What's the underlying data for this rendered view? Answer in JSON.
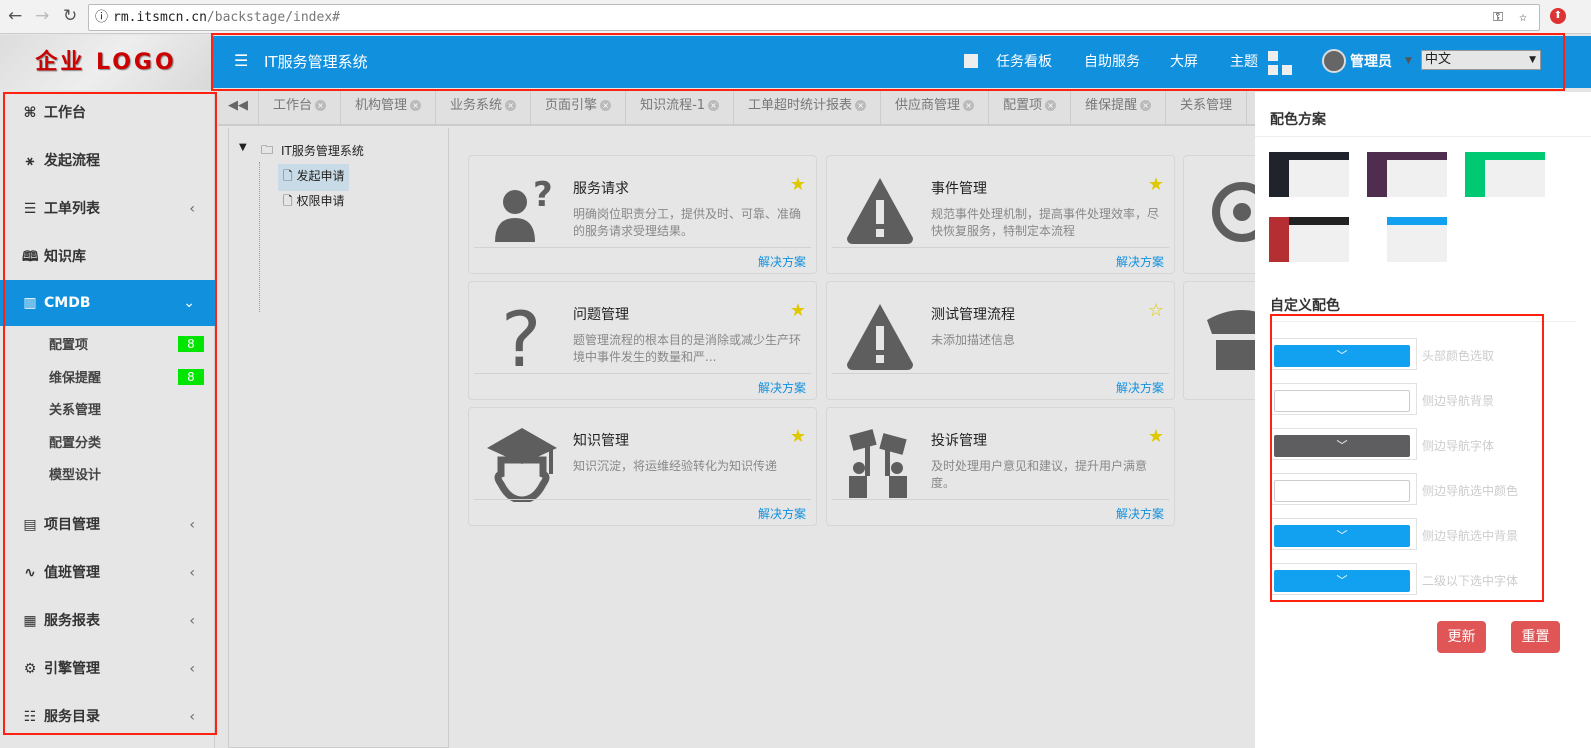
{
  "browser": {
    "url_host": "rm.itsmcn.cn",
    "url_path": "/backstage/index#"
  },
  "logo": "企业 LOGO",
  "header": {
    "title": "IT服务管理系统",
    "links": [
      "任务看板",
      "自助服务",
      "大屏",
      "主题"
    ],
    "user": "管理员",
    "language": "中文",
    "color": "#1190de"
  },
  "tabs": [
    "工作台",
    "机构管理",
    "业务系统",
    "页面引擎",
    "知识流程-1",
    "工单超时统计报表",
    "供应商管理",
    "配置项",
    "维保提醒",
    "关系管理"
  ],
  "sidebar": {
    "items": [
      {
        "label": "工作台",
        "icon": "grid-icon"
      },
      {
        "label": "发起流程",
        "icon": "flow-icon"
      },
      {
        "label": "工单列表",
        "icon": "list-icon",
        "chevron": true
      },
      {
        "label": "知识库",
        "icon": "book-icon"
      },
      {
        "label": "CMDB",
        "icon": "chart-icon",
        "chevron": true,
        "active": true
      },
      {
        "label": "项目管理",
        "icon": "project-icon",
        "chevron": true
      },
      {
        "label": "值班管理",
        "icon": "pulse-icon",
        "chevron": true
      },
      {
        "label": "服务报表",
        "icon": "report-icon",
        "chevron": true
      },
      {
        "label": "引擎管理",
        "icon": "gear-icon",
        "chevron": true
      },
      {
        "label": "服务目录",
        "icon": "catalog-icon",
        "chevron": true
      }
    ],
    "sub": [
      {
        "label": "配置项",
        "badge": "8"
      },
      {
        "label": "维保提醒",
        "badge": "8"
      },
      {
        "label": "关系管理"
      },
      {
        "label": "配置分类"
      },
      {
        "label": "模型设计"
      }
    ]
  },
  "tree": {
    "root": "IT服务管理系统",
    "children": [
      "发起申请",
      "权限申请"
    ],
    "selected": "发起申请"
  },
  "cards": [
    {
      "title": "服务请求",
      "desc": "明确岗位职责分工，提供及时、可靠、准确的服务请求受理结果。",
      "starred": true,
      "icon": "person-question-icon",
      "link": "解决方案"
    },
    {
      "title": "事件管理",
      "desc": "规范事件处理机制，提高事件处理效率，尽快恢复服务，特制定本流程",
      "starred": true,
      "icon": "warning-icon",
      "link": "解决方案"
    },
    {
      "title": "",
      "desc": "",
      "starred": false,
      "icon": "gear-refresh-icon",
      "link": ""
    },
    {
      "title": "问题管理",
      "desc": "题管理流程的根本目的是消除或减少生产环境中事件发生的数量和严...",
      "starred": true,
      "icon": "question-icon",
      "link": "解决方案"
    },
    {
      "title": "测试管理流程",
      "desc": "未添加描述信息",
      "starred": false,
      "icon": "warning-icon",
      "link": "解决方案"
    },
    {
      "title": "",
      "desc": "",
      "starred": false,
      "icon": "police-icon",
      "link": ""
    },
    {
      "title": "知识管理",
      "desc": "知识沉淀，将运维经验转化为知识传递",
      "starred": true,
      "icon": "graduate-icon",
      "link": "解决方案"
    },
    {
      "title": "投诉管理",
      "desc": "及时处理用户意见和建议，提升用户满意度。",
      "starred": true,
      "icon": "protest-icon",
      "link": "解决方案"
    }
  ],
  "panel": {
    "scheme_title": "配色方案",
    "schemes": [
      {
        "side": "#20232b",
        "top": "#20232b"
      },
      {
        "side": "#4f2d4f",
        "top": "#4f2d4f"
      },
      {
        "side": "#00c973",
        "top": "#00c973"
      },
      {
        "side": "#b52e31",
        "top": "#222222"
      },
      {
        "side": "#ffffff",
        "top": "#12a0f0"
      }
    ],
    "custom_title": "自定义配色",
    "custom": [
      {
        "label": "头部颜色选取",
        "color": "#12a0f0"
      },
      {
        "label": "侧边导航背景",
        "color": "#ffffff"
      },
      {
        "label": "侧边导航字体",
        "color": "#5e5e60"
      },
      {
        "label": "侧边导航选中颜色",
        "color": "#ffffff"
      },
      {
        "label": "侧边导航选中背景",
        "color": "#12a0f0"
      },
      {
        "label": "二级以下选中字体",
        "color": "#12a0f0"
      }
    ],
    "update": "更新",
    "reset": "重置"
  }
}
